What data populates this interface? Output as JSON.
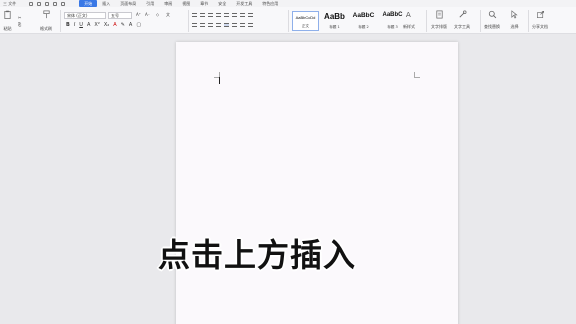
{
  "menubar": {
    "file_label": "三 文件",
    "tabs": [
      {
        "label": "开始",
        "active": true
      },
      {
        "label": "插入",
        "active": false
      },
      {
        "label": "页面布局",
        "active": false
      },
      {
        "label": "引用",
        "active": false
      },
      {
        "label": "审阅",
        "active": false
      },
      {
        "label": "视图",
        "active": false
      },
      {
        "label": "章节",
        "active": false
      },
      {
        "label": "安全",
        "active": false
      },
      {
        "label": "开发工具",
        "active": false
      },
      {
        "label": "特色应用",
        "active": false
      }
    ]
  },
  "ribbon": {
    "paste_label": "粘贴",
    "format_painter_label": "格式刷",
    "font_name": "宋体 (正文)",
    "font_size": "五号",
    "styles": [
      {
        "preview": "AaBbCcDd",
        "name": "正文"
      },
      {
        "preview": "AaBb",
        "name": "标题 1"
      },
      {
        "preview": "AaBbC",
        "name": "标题 2"
      },
      {
        "preview": "AaBbC",
        "name": "标题 3"
      }
    ],
    "new_style_label": "新样式",
    "text_layout_label": "文字排版",
    "text_tools_label": "文字工具",
    "find_replace_label": "查找替换",
    "select_label": "选择",
    "share_label": "分享文档"
  },
  "caption": "点击上方插入",
  "colors": {
    "accent": "#3a78e6",
    "page": "#fbf9fc",
    "workspace": "#e9e9ec"
  }
}
